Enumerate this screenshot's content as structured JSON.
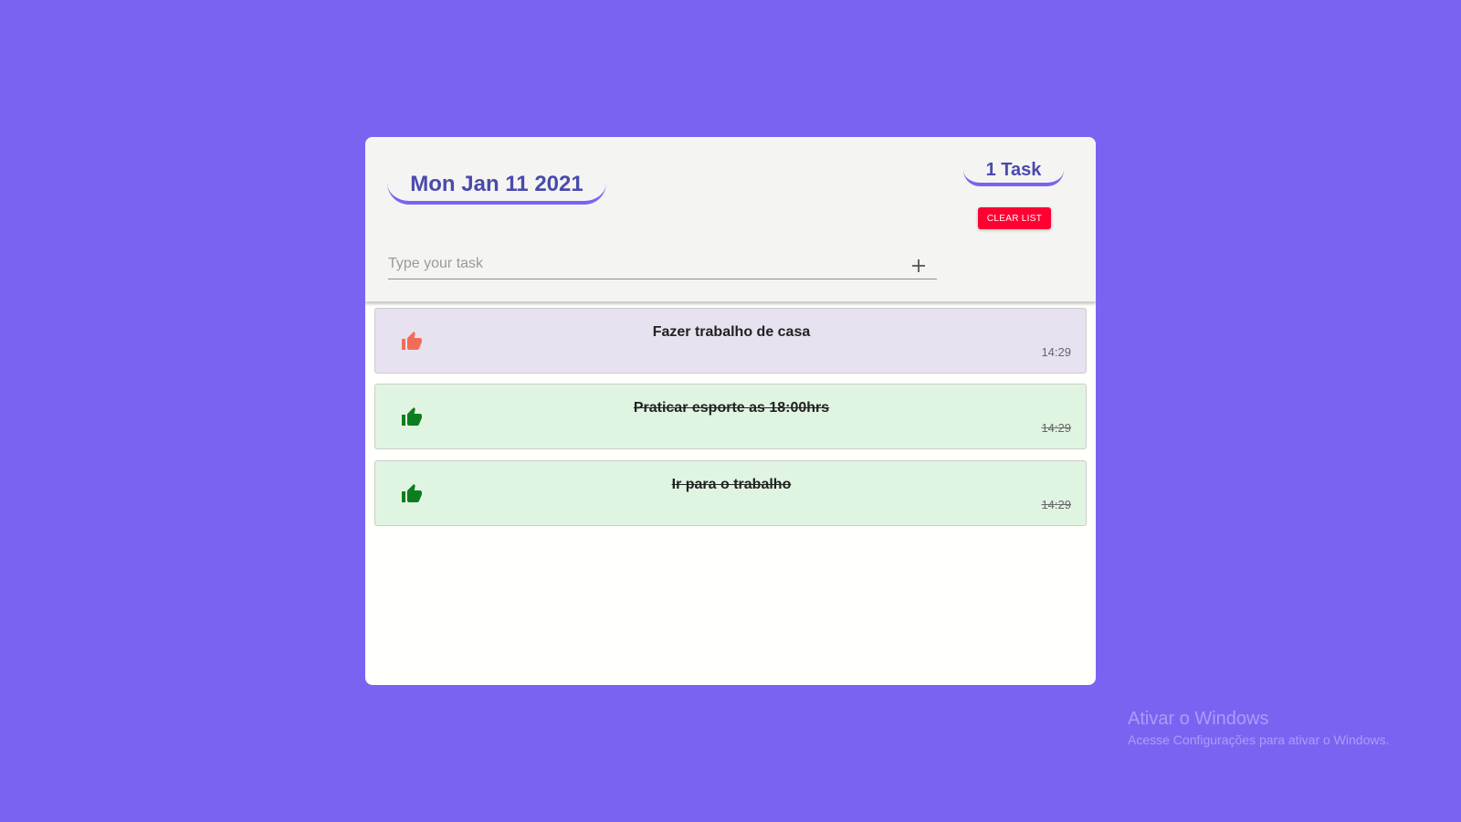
{
  "header": {
    "date": "Mon Jan 11 2021",
    "task_count": "1 Task",
    "clear_label": "CLEAR LIST"
  },
  "input": {
    "placeholder": "Type your task",
    "add_icon": "plus-icon"
  },
  "tasks": [
    {
      "text": "Fazer trabalho de casa",
      "time": "14:29",
      "done": false,
      "bg": "#e8e1ef",
      "icon_color": "#f26d58"
    },
    {
      "text": "Praticar esporte as 18:00hrs",
      "time": "14:29",
      "done": true,
      "bg": "#e0f5e1",
      "icon_color": "#0d7d1d"
    },
    {
      "text": "Ir para o trabalho",
      "time": "14:29",
      "done": true,
      "bg": "#e0f5e1",
      "icon_color": "#0d7d1d"
    }
  ],
  "colors": {
    "background": "#7b63f2",
    "title": "#4a4aac",
    "accent": "#7b63f2",
    "danger": "#ff0033"
  },
  "watermark": {
    "title": "Ativar o Windows",
    "subtitle": "Acesse Configurações para ativar o Windows."
  }
}
